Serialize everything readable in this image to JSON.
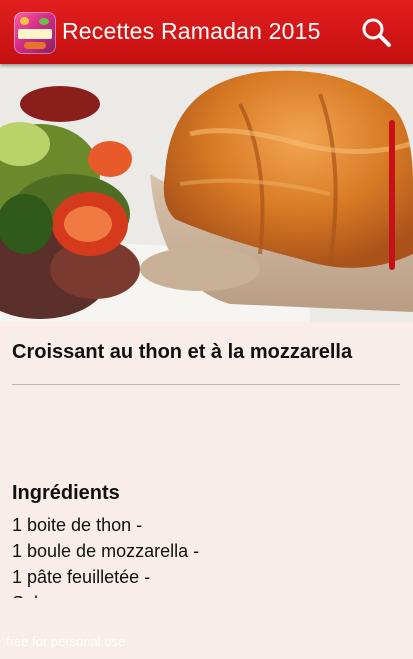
{
  "app": {
    "title": "Recettes Ramadan 2015",
    "icon_text": "Recettes Ramadan"
  },
  "icons": {
    "app": "app-logo-icon",
    "search": "search-icon"
  },
  "colors": {
    "accent": "#d41414",
    "background": "#f8ede8"
  },
  "recipe": {
    "title": "Croissant au thon et à la mozzarella",
    "ingredients_heading": "Ingrédients",
    "ingredients": [
      "1 boite de thon -",
      "1 boule de mozzarella -",
      "1 pâte feuilletée -",
      "Sel"
    ]
  },
  "watermark": "free for personal use"
}
